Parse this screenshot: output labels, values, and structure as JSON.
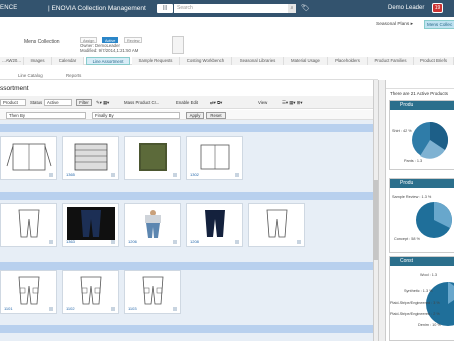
{
  "topbar": {
    "brand": "ENCE",
    "app_name": "| ENOVIA Collection Management",
    "dropdown": "|||",
    "search_placeholder": "Search",
    "search_go": "⌕",
    "tag_icon": "tag-icon",
    "user": "Demo Leader",
    "notif": "19"
  },
  "header": {
    "seasonal_plans": "Seasonal Plans ▸",
    "mens_collection_btn": "Mens Collec",
    "context_title": "Mens Collection",
    "states": [
      "Assign",
      "Active",
      "Review"
    ],
    "owner_line": "Owner:  DemoLeader",
    "modified_line": "Modified: 9/7/2014,1:21:50 AM"
  },
  "tabs": [
    "...AW20...",
    "Images",
    "Calendar",
    "Line Assortment",
    "Sample Requests",
    "Costing Workbench",
    "Seasonal Libraries",
    "Material Usage",
    "Placeholders",
    "Product Families",
    "Product Briefs"
  ],
  "subtabs": [
    "Line Catalog",
    "Reports"
  ],
  "section_title": "ssortment",
  "toolbar": {
    "product_select": "Product",
    "status_label": "Status",
    "status_value": "Active",
    "filter_btn": "Filter",
    "mass_product": "Mass Product Cr...",
    "enable_edit": "Enable Edit",
    "view": "View"
  },
  "sort": {
    "then_by": "Then By",
    "finally_by": "Finally By",
    "apply": "Apply",
    "reset": "Reset"
  },
  "grid": {
    "rows": [
      {
        "cards": [
          {
            "label": "",
            "kind": "jacket"
          },
          {
            "label": "1365",
            "kind": "puffer"
          },
          {
            "label": "",
            "kind": "parka-dark"
          },
          {
            "label": "1302",
            "kind": "jacket2"
          }
        ]
      },
      {
        "cards": [
          {
            "label": "",
            "kind": "pants"
          },
          {
            "label": "1363",
            "kind": "jeans-dark"
          },
          {
            "label": "1206",
            "kind": "jeans-photo"
          },
          {
            "label": "1208",
            "kind": "pants-dark"
          },
          {
            "label": "",
            "kind": "pants"
          }
        ]
      },
      {
        "cards": [
          {
            "label": "1101",
            "kind": "cargo"
          },
          {
            "label": "1102",
            "kind": "cargo"
          },
          {
            "label": "1103",
            "kind": "cargo"
          }
        ]
      }
    ]
  },
  "right_panel": {
    "count_text": "There are 21 Active Products",
    "panels": [
      {
        "title": "Produ",
        "labels": [
          "Shirt : 42 %",
          "Pants : 1.3"
        ]
      },
      {
        "title": "Produ",
        "labels": [
          "Sample Review : 1.3 %",
          "Concept : 58 %"
        ]
      },
      {
        "title": "Const",
        "labels": [
          "Wool : 1.3",
          "Synthetic : 1.3 %",
          "Plaid-Stripe/Engineered : 3 %",
          "Plaid-Stripe/Engineered : 2 %",
          "Denim : 10 %"
        ]
      }
    ]
  },
  "colors": {
    "topbar": "#33536e",
    "accent": "#2b6f8c",
    "band": "#b8d0ee",
    "notif": "#cc3333"
  }
}
